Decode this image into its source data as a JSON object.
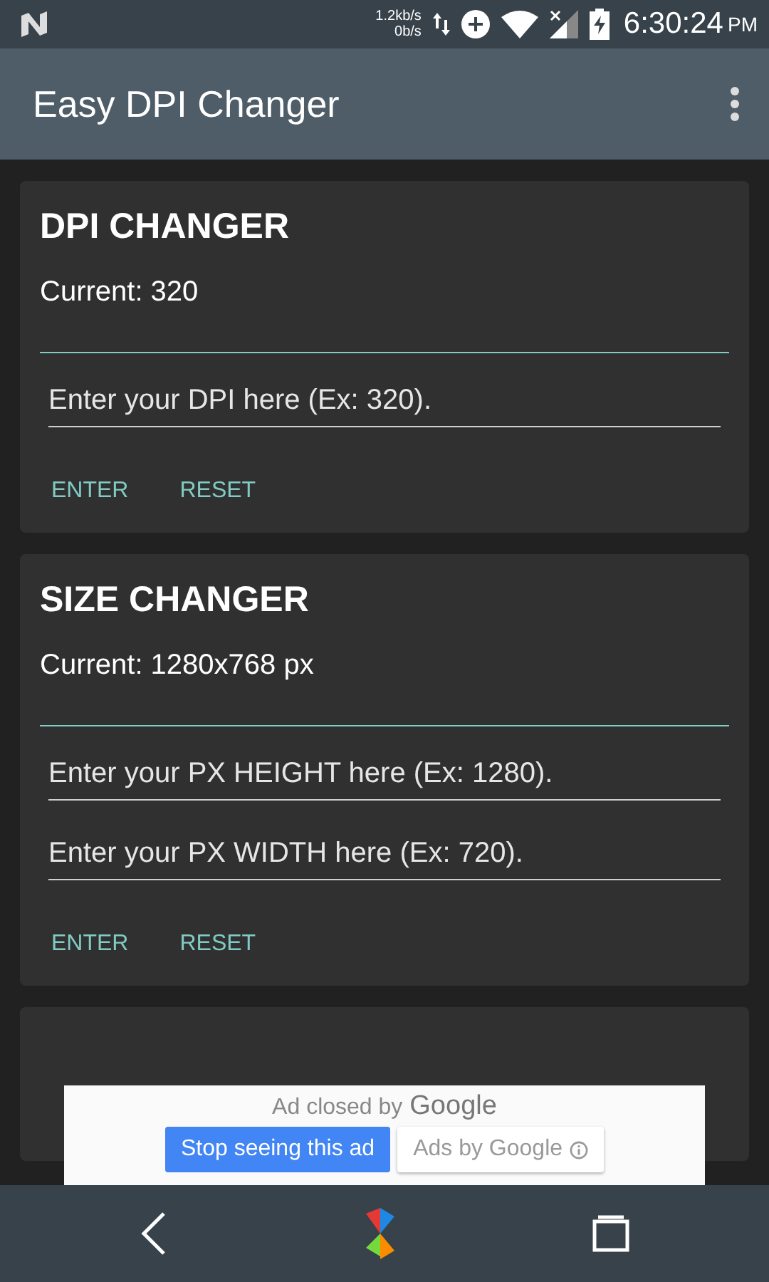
{
  "status_bar": {
    "speed_up": "1.2kb/s",
    "speed_down": "0b/s",
    "time": "6:30:24",
    "time_suffix": "PM"
  },
  "app_bar": {
    "title": "Easy DPI Changer"
  },
  "cards": [
    {
      "title": "DPI CHANGER",
      "current": "Current: 320",
      "fields": [
        {
          "placeholder": "Enter your DPI here (Ex: 320)."
        }
      ],
      "buttons": [
        "ENTER",
        "RESET"
      ]
    },
    {
      "title": "SIZE CHANGER",
      "current": "Current: 1280x768 px",
      "fields": [
        {
          "placeholder": "Enter your PX HEIGHT here (Ex: 1280)."
        },
        {
          "placeholder": "Enter your PX WIDTH here (Ex: 720)."
        }
      ],
      "buttons": [
        "ENTER",
        "RESET"
      ]
    }
  ],
  "ad": {
    "notice": "Ad closed by",
    "brand": "Google",
    "stop_button": "Stop seeing this ad",
    "info_button": "Ads by Google"
  }
}
